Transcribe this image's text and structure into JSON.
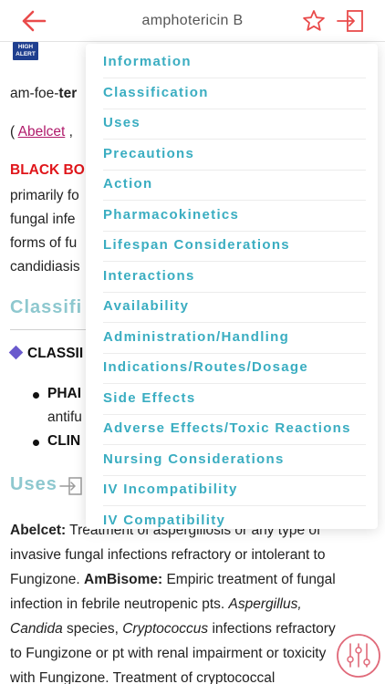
{
  "header": {
    "title": "amphotericin B"
  },
  "badge": {
    "line1": "HIGH",
    "line2": "ALERT"
  },
  "monograph": {
    "pron_prefix": "am-foe-",
    "pron_bold": "ter",
    "brand_open": "( ",
    "brand_link": "Abelcet",
    "brand_sep": " ,",
    "black_box": "BLACK BO",
    "bb_lines": [
      "primarily fo",
      "fungal infe",
      "forms of fu",
      "candidiasis"
    ],
    "classif_title": "Classifi",
    "classif_head": "CLASSII",
    "bullet1": "PHAI",
    "bullet1_sub": "antifu",
    "bullet2": "CLIN",
    "uses_title": "Uses",
    "uses": {
      "l1_bold": "Abelcet:",
      "l1": " Treatment of aspergillosis or any type of",
      "l2": "invasive fungal infections refractory or intolerant to",
      "l3a": "Fungizone. ",
      "l3b": "AmBisome:",
      "l3c": " Empiric treatment of fungal",
      "l4a": "infection in febrile neutropenic pts. ",
      "l4b": "Aspergillus,",
      "l5a": "Candida",
      "l5b": " species, ",
      "l5c": "Cryptococcus",
      "l5d": " infections refractory",
      "l6": "to Fungizone or pt with renal impairment or toxicity",
      "l7": "with Fungizone. Treatment of cryptococcal"
    }
  },
  "menu": {
    "items": [
      {
        "label": "Information"
      },
      {
        "label": "Classification"
      },
      {
        "label": "Uses"
      },
      {
        "label": "Precautions"
      },
      {
        "label": "Action"
      },
      {
        "label": "Pharmacokinetics"
      },
      {
        "label": "Lifespan Considerations"
      },
      {
        "label": "Interactions"
      },
      {
        "label": "Availability"
      },
      {
        "label": "Administration/Handling"
      },
      {
        "label": "Indications/Routes/Dosage"
      },
      {
        "label": "Side Effects"
      },
      {
        "label": "Adverse Effects/Toxic Reactions"
      },
      {
        "label": "Nursing Considerations"
      },
      {
        "label": "IV Incompatibility"
      },
      {
        "label": "IV Compatibility"
      }
    ]
  },
  "icons": {
    "back": "back-arrow-icon",
    "favorite": "star-icon",
    "jump": "jump-to-section-icon",
    "uses_jump": "section-jump-icon",
    "tools": "tools-icon"
  },
  "colors": {
    "accent_red": "#e94b4b",
    "menu_teal": "#3aadc1",
    "section_teal": "#8ec8cf",
    "black_box_red": "#e0151a",
    "link_magenta": "#b01b6b",
    "badge_blue": "#1f3f8f"
  }
}
